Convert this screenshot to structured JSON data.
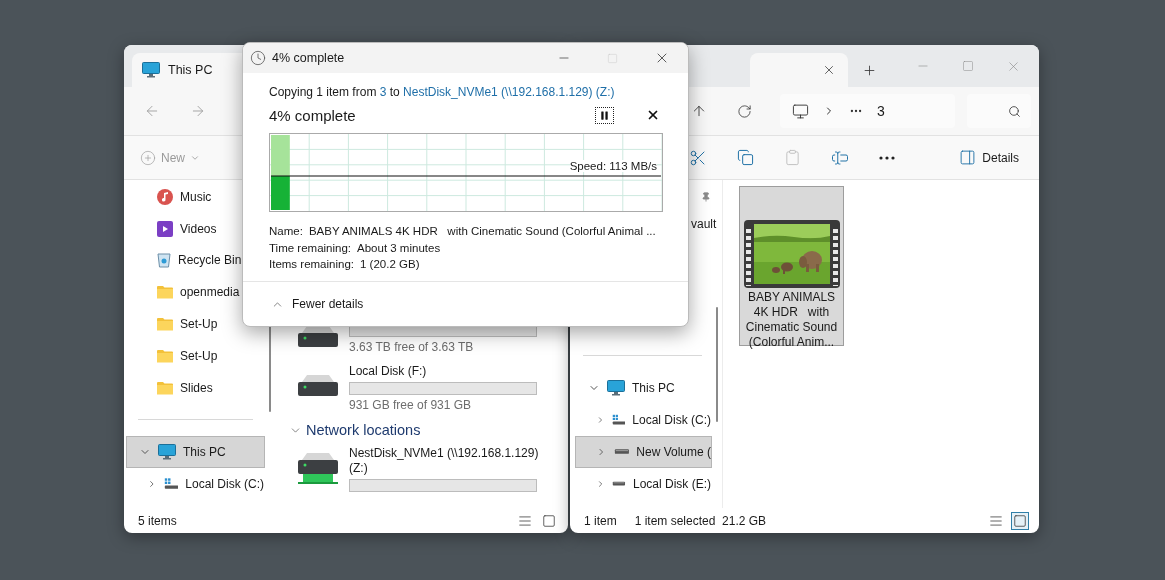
{
  "left_window": {
    "tab": {
      "title": "This PC"
    },
    "toolbar": {
      "new_label": "New"
    },
    "sidebar": {
      "items": [
        {
          "label": "Music",
          "kind": "music"
        },
        {
          "label": "Videos",
          "kind": "videos"
        },
        {
          "label": "Recycle Bin",
          "kind": "recycle"
        },
        {
          "label": "openmedia",
          "kind": "folder"
        },
        {
          "label": "Set-Up",
          "kind": "folder"
        },
        {
          "label": "Set-Up",
          "kind": "folder"
        },
        {
          "label": "Slides",
          "kind": "folder"
        }
      ],
      "tree": [
        {
          "label": "This PC",
          "kind": "pc",
          "selected": true,
          "expanded": true,
          "children": [
            {
              "label": "Local Disk (C:)",
              "kind": "windrive",
              "selected": false,
              "expanded": false
            }
          ]
        }
      ]
    },
    "drives": [
      {
        "kind": "hdd",
        "free": "3.63 TB free of 3.63 TB",
        "level": 0
      },
      {
        "kind": "hdd",
        "name": "Local Disk (F:)",
        "free": "931 GB free of 931 GB",
        "level": 0
      }
    ],
    "network": {
      "title": "Network locations",
      "expanded": true,
      "items": [
        {
          "kind": "network",
          "name": "NestDisk_NVMe1 (\\\\192.168.1.129) (Z:)",
          "level": 0
        }
      ]
    },
    "status": {
      "count": "5 items"
    },
    "view_buttons": [
      {
        "kind": "details",
        "selected": false
      },
      {
        "kind": "tiles",
        "selected": false
      }
    ]
  },
  "right_window": {
    "address": {
      "segments": [
        "3"
      ]
    },
    "toolbar": {
      "actions": [
        {
          "kind": "cut",
          "disabled": false
        },
        {
          "kind": "copy",
          "disabled": false
        },
        {
          "kind": "paste",
          "disabled": true
        },
        {
          "kind": "rename",
          "disabled": false
        },
        {
          "kind": "more",
          "disabled": false
        }
      ],
      "details_label": "Details"
    },
    "sidebar": {
      "partial_item": "vault",
      "tree": [
        {
          "label": "This PC",
          "kind": "pc",
          "selected": false,
          "expanded": true,
          "children": [
            {
              "label": "Local Disk (C:)",
              "kind": "windrive",
              "selected": false,
              "expanded": false
            },
            {
              "label": "New Volume (",
              "kind": "drive",
              "selected": true,
              "expanded": false
            },
            {
              "label": "Local Disk (E:)",
              "kind": "drive",
              "selected": false,
              "expanded": false
            }
          ]
        }
      ]
    },
    "files": [
      {
        "kind": "video",
        "name": "BABY ANIMALS 4K HDR   with Cinematic Sound (Colorful Anim...",
        "selected": true
      }
    ],
    "status": {
      "count": "1 item",
      "selection": "1 item selected  21.2 GB"
    },
    "view_buttons": [
      {
        "kind": "details",
        "selected": false
      },
      {
        "kind": "tiles",
        "selected": true
      }
    ]
  },
  "dialog": {
    "title": "4% complete",
    "copying": {
      "prefix": "Copying 1 item from ",
      "source": "3",
      "middle": " to ",
      "destination": "NestDisk_NVMe1 (\\\\192.168.1.129) (Z:)"
    },
    "heading": "4% complete",
    "progress": {
      "level": 0.04,
      "speed": "Speed: 113 MB/s"
    },
    "details": [
      {
        "label": "Name:",
        "value": "BABY ANIMALS 4K HDR   with Cinematic Sound (Colorful Animal ..."
      },
      {
        "label": "Time remaining:",
        "value": "About 3 minutes"
      },
      {
        "label": "Items remaining:",
        "value": "1 (20.2 GB)"
      }
    ],
    "footer": {
      "label": "Fewer details",
      "expanded": true
    }
  }
}
